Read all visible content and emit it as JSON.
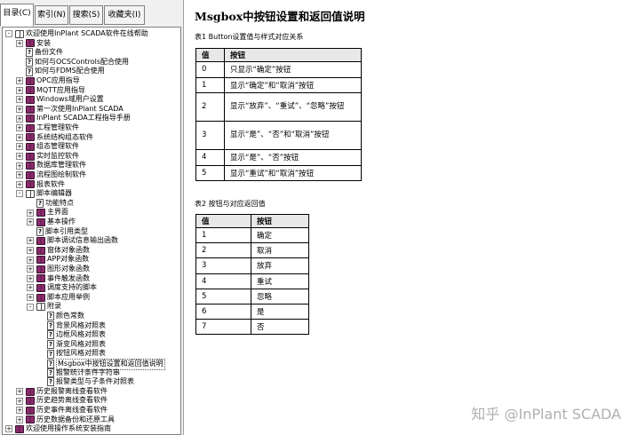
{
  "tabs": [
    "目录(C)",
    "索引(N)",
    "搜索(S)",
    "收藏夹(I)"
  ],
  "tree": [
    {
      "label": "欢迎使用InPlant SCADA软件在线帮助",
      "icon": "open",
      "exp": "-"
    },
    {
      "label": "安装",
      "icon": "book",
      "exp": "+"
    },
    {
      "label": "备份文件",
      "icon": "page",
      "exp": ""
    },
    {
      "label": "如何与OCSControls配合使用",
      "icon": "page",
      "exp": ""
    },
    {
      "label": "如何与FDMS配合使用",
      "icon": "page",
      "exp": ""
    },
    {
      "label": "OPC应用指导",
      "icon": "book",
      "exp": "+"
    },
    {
      "label": "MQTT应用指导",
      "icon": "book",
      "exp": "+"
    },
    {
      "label": "Windows域用户设置",
      "icon": "book",
      "exp": "+"
    },
    {
      "label": "第一次使用InPlant SCADA",
      "icon": "book",
      "exp": "+"
    },
    {
      "label": "InPlant SCADA工程指导手册",
      "icon": "book",
      "exp": "+"
    },
    {
      "label": "工程管理软件",
      "icon": "book",
      "exp": "+"
    },
    {
      "label": "系统结构组态软件",
      "icon": "book",
      "exp": "+"
    },
    {
      "label": "组态管理软件",
      "icon": "book",
      "exp": "+"
    },
    {
      "label": "实时监控软件",
      "icon": "book",
      "exp": "+"
    },
    {
      "label": "数据库管理软件",
      "icon": "book",
      "exp": "+"
    },
    {
      "label": "流程图绘制软件",
      "icon": "book",
      "exp": "+"
    },
    {
      "label": "报表软件",
      "icon": "book",
      "exp": "+"
    },
    {
      "label": "脚本编辑器",
      "icon": "open",
      "exp": "-"
    },
    {
      "label": "功能特点",
      "icon": "page",
      "exp": ""
    },
    {
      "label": "主界面",
      "icon": "book",
      "exp": "+"
    },
    {
      "label": "基本操作",
      "icon": "book",
      "exp": "+"
    },
    {
      "label": "脚本引用类型",
      "icon": "page",
      "exp": ""
    },
    {
      "label": "脚本调试信息输出函数",
      "icon": "book",
      "exp": "+"
    },
    {
      "label": "窗体对象函数",
      "icon": "book",
      "exp": "+"
    },
    {
      "label": "APP对象函数",
      "icon": "book",
      "exp": "+"
    },
    {
      "label": "图形对象函数",
      "icon": "book",
      "exp": "+"
    },
    {
      "label": "事件触发函数",
      "icon": "book",
      "exp": "+"
    },
    {
      "label": "调度支持的脚本",
      "icon": "book",
      "exp": "+"
    },
    {
      "label": "脚本应用举例",
      "icon": "book",
      "exp": "+"
    },
    {
      "label": "附录",
      "icon": "open",
      "exp": "-"
    },
    {
      "label": "颜色常数",
      "icon": "page",
      "exp": ""
    },
    {
      "label": "背景风格对照表",
      "icon": "page",
      "exp": ""
    },
    {
      "label": "边框风格对照表",
      "icon": "page",
      "exp": ""
    },
    {
      "label": "渐变风格对照表",
      "icon": "page",
      "exp": ""
    },
    {
      "label": "按钮风格对照表",
      "icon": "page",
      "exp": ""
    },
    {
      "label": "Msgbox中按钮设置和返回值说明",
      "icon": "page",
      "exp": ""
    },
    {
      "label": "报警统计条件字符串",
      "icon": "page",
      "exp": ""
    },
    {
      "label": "报警类型与子条件对照表",
      "icon": "page",
      "exp": ""
    },
    {
      "label": "历史报警离线查看软件",
      "icon": "book",
      "exp": "+"
    },
    {
      "label": "历史趋势离线查看软件",
      "icon": "book",
      "exp": "+"
    },
    {
      "label": "历史事件离线查看软件",
      "icon": "book",
      "exp": "+"
    },
    {
      "label": "历史数据备份和还原工具",
      "icon": "book",
      "exp": "+"
    },
    {
      "label": "欢迎使用操作系统安装指南",
      "icon": "book",
      "exp": "+"
    }
  ],
  "doc": {
    "title": "Msgbox中按钮设置和返回值说明",
    "table1_caption": "表1 Button设置值与样式对应关系",
    "table1_headers": [
      "值",
      "按钮"
    ],
    "table1_rows": [
      [
        "0",
        "只显示“确定”按钮"
      ],
      [
        "1",
        "显示“确定”和“取消”按钮"
      ],
      [
        "2",
        "显示“放弃”、“重试”、“忽略”按钮"
      ],
      [
        "3",
        "显示“是”、“否”和“取消”按钮"
      ],
      [
        "4",
        "显示“是”、“否”按钮"
      ],
      [
        "5",
        "显示“重试”和“取消”按钮"
      ]
    ],
    "table2_caption": "表2 按钮与对应返回值",
    "table2_headers": [
      "值",
      "按钮"
    ],
    "table2_rows": [
      [
        "1",
        "确定"
      ],
      [
        "2",
        "取消"
      ],
      [
        "3",
        "放弃"
      ],
      [
        "4",
        "重试"
      ],
      [
        "5",
        "忽略"
      ],
      [
        "6",
        "是"
      ],
      [
        "7",
        "否"
      ]
    ]
  },
  "watermark": "知乎 @InPlant SCADA"
}
